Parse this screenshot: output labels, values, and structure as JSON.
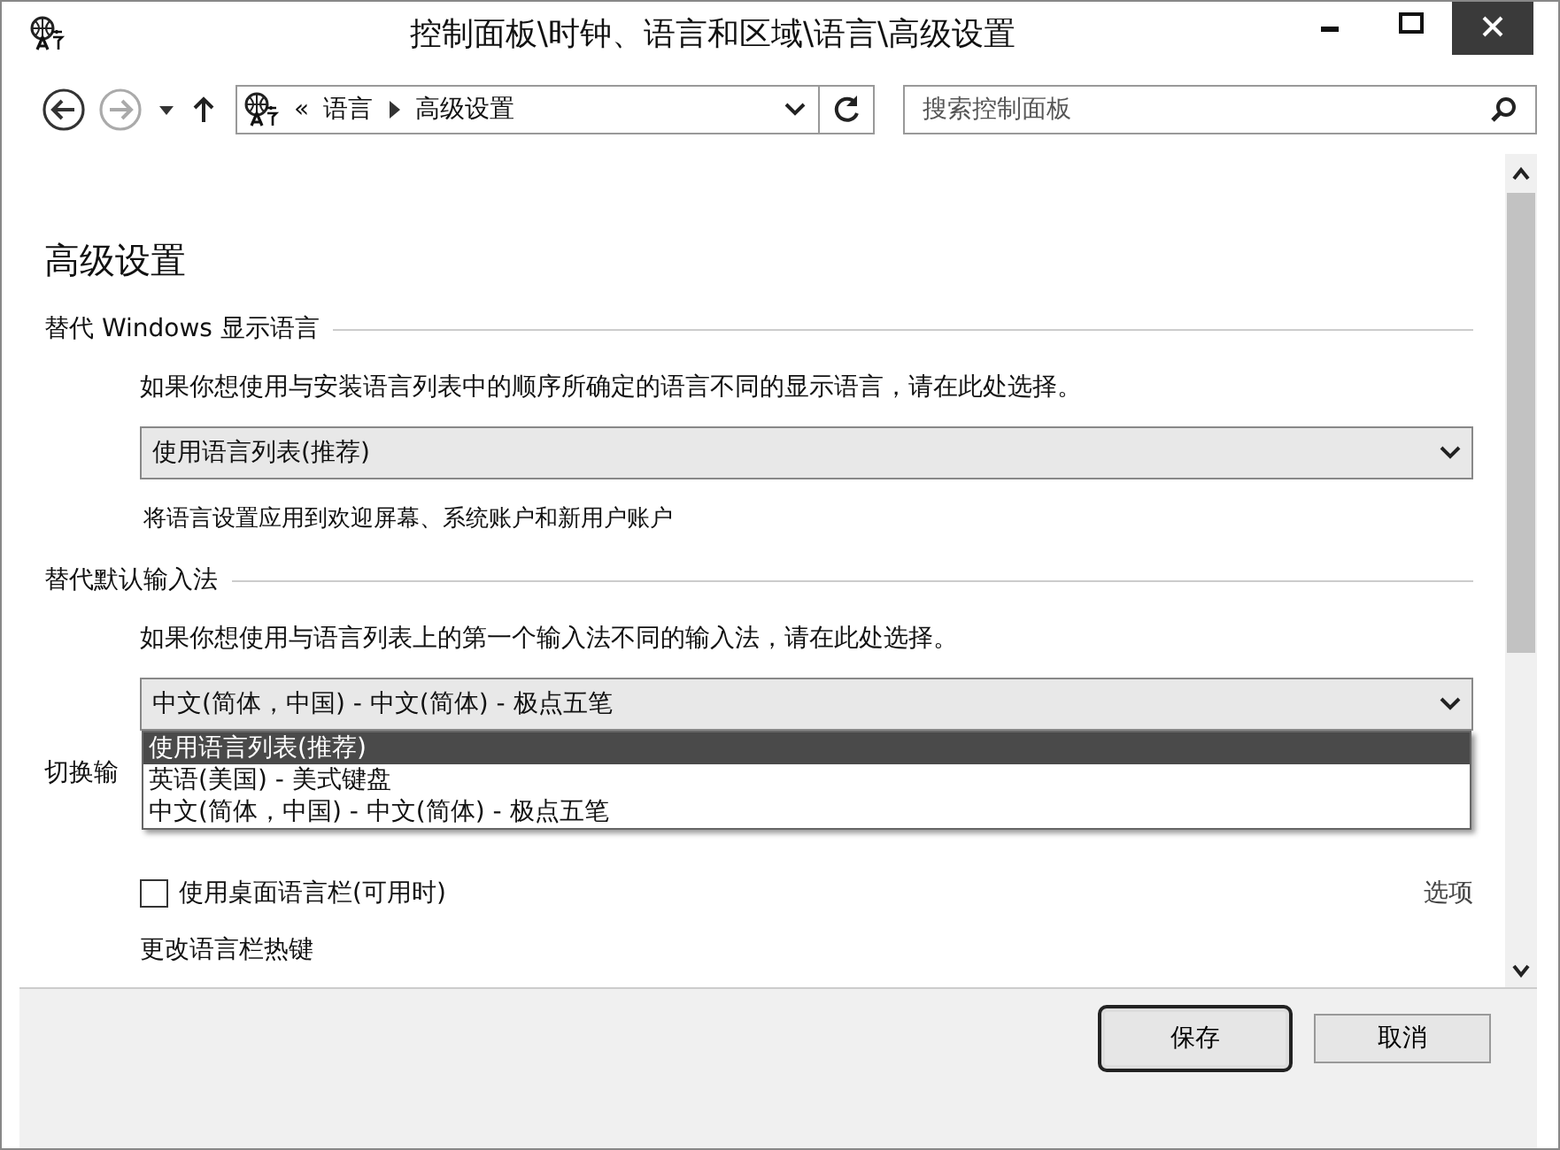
{
  "window": {
    "title": "控制面板\\时钟、语言和区域\\语言\\高级设置"
  },
  "address_bar": {
    "separator": "«",
    "crumbs": [
      "语言",
      "高级设置"
    ]
  },
  "search": {
    "placeholder": "搜索控制面板"
  },
  "page_title": "高级设置",
  "display_language": {
    "heading": "替代 Windows 显示语言",
    "description": "如果你想使用与安装语言列表中的顺序所确定的语言不同的显示语言，请在此处选择。",
    "dropdown": {
      "value": "使用语言列表(推荐)"
    },
    "link": "将语言设置应用到欢迎屏幕、系统账户和新用户账户"
  },
  "input_method": {
    "heading": "替代默认输入法",
    "description": "如果你想使用与语言列表上的第一个输入法不同的输入法，请在此处选择。",
    "dropdown": {
      "value": "中文(简体，中国) - 中文(简体) - 极点五笔",
      "expanded": true,
      "options": [
        {
          "label": "使用语言列表(推荐)",
          "highlighted": true
        },
        {
          "label": "英语(美国) - 美式键盘",
          "highlighted": false
        },
        {
          "label": "中文(简体，中国) - 中文(简体) - 极点五笔",
          "highlighted": false
        }
      ]
    }
  },
  "switching": {
    "heading": "切换输",
    "checkbox": {
      "label": "使用桌面语言栏(可用时)",
      "checked": false
    },
    "options_link": "选项",
    "hotkeys_link": "更改语言栏热键"
  },
  "buttons": [
    {
      "label": "保存",
      "default": true
    },
    {
      "label": "取消",
      "default": false
    }
  ]
}
